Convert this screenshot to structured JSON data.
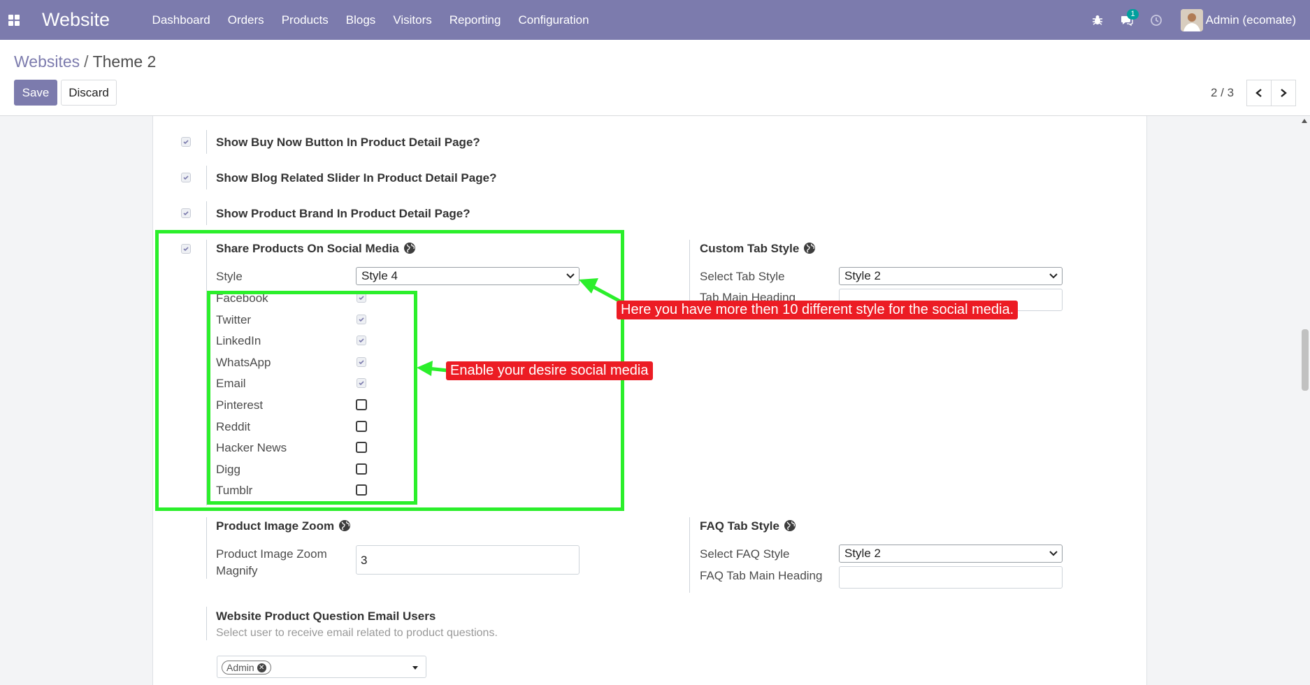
{
  "navbar": {
    "brand": "Website",
    "menu": [
      "Dashboard",
      "Orders",
      "Products",
      "Blogs",
      "Visitors",
      "Reporting",
      "Configuration"
    ],
    "chat_badge": "1",
    "user": "Admin (ecomate)"
  },
  "control": {
    "breadcrumb_parent": "Websites",
    "breadcrumb_sep": "/",
    "breadcrumb_current": "Theme 2",
    "save_label": "Save",
    "discard_label": "Discard",
    "pager": "2 / 3"
  },
  "form": {
    "buy_now": "Show Buy Now Button In Product Detail Page?",
    "blog_slider": "Show Blog Related Slider In Product Detail Page?",
    "product_brand": "Show Product Brand In Product Detail Page?",
    "share_title": "Share Products On Social Media",
    "style_label": "Style",
    "style_value": "Style 4",
    "social": [
      {
        "label": "Facebook",
        "checked": true
      },
      {
        "label": "Twitter",
        "checked": true
      },
      {
        "label": "LinkedIn",
        "checked": true
      },
      {
        "label": "WhatsApp",
        "checked": true
      },
      {
        "label": "Email",
        "checked": true
      },
      {
        "label": "Pinterest",
        "checked": false
      },
      {
        "label": "Reddit",
        "checked": false
      },
      {
        "label": "Hacker News",
        "checked": false
      },
      {
        "label": "Digg",
        "checked": false
      },
      {
        "label": "Tumblr",
        "checked": false
      }
    ],
    "custom_tab_title": "Custom Tab Style",
    "select_tab_label": "Select Tab Style",
    "select_tab_value": "Style 2",
    "tab_main_heading_label": "Tab Main Heading",
    "zoom_title": "Product Image Zoom",
    "zoom_label_line1": "Product Image Zoom",
    "zoom_label_line2": "Magnify",
    "zoom_value": "3",
    "faq_title": "FAQ Tab Style",
    "faq_select_label": "Select FAQ Style",
    "faq_select_value": "Style 2",
    "faq_heading_label": "FAQ Tab Main Heading",
    "question_title": "Website Product Question Email Users",
    "question_hint": "Select user to receive email related to product questions.",
    "question_tag": "Admin"
  },
  "annotations": {
    "style_callout": "Here you have more then 10 different style for the social media.",
    "social_callout": "Enable your desire social media"
  },
  "colors": {
    "navbar": "#7c7bad",
    "annotation_green": "#2bef2b",
    "callout_red": "#ec1c24"
  }
}
